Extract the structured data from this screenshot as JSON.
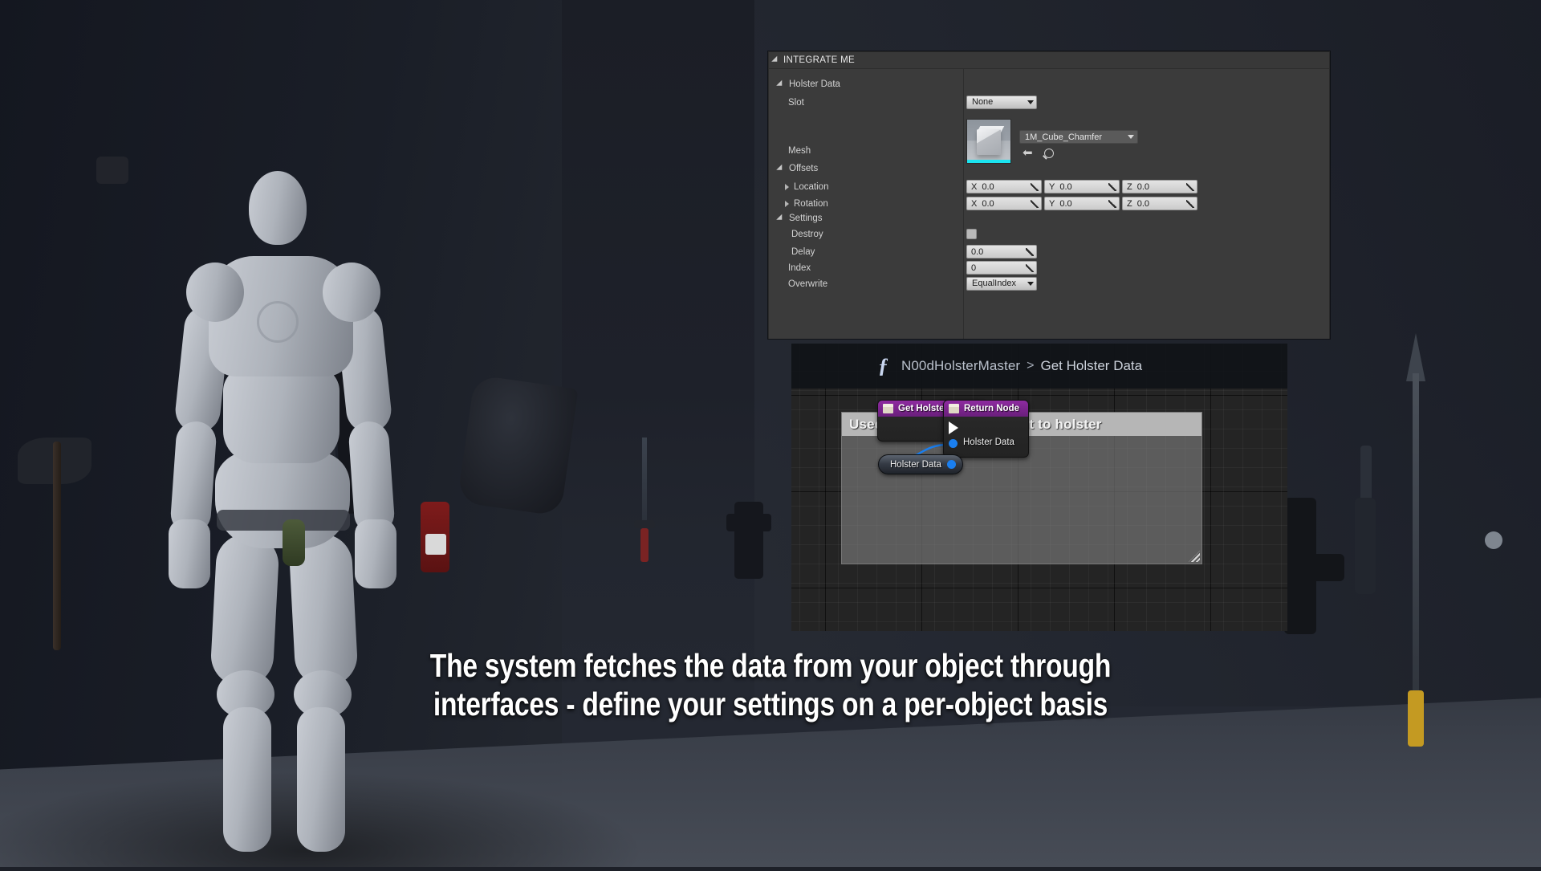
{
  "viewport": {
    "scene_description": "Unreal Engine mannequin with holstered weapons in a dark showcase room",
    "props": [
      "axe",
      "sword",
      "pistol",
      "rifle",
      "spear",
      "mace",
      "orb"
    ]
  },
  "details_panel": {
    "header": {
      "title": "INTEGRATE ME",
      "expander_icon": "triangle-down-icon"
    },
    "categories": [
      {
        "name": "Holster Data",
        "expander_icon": "triangle-down-icon"
      },
      {
        "name": "Offsets",
        "expander_icon": "triangle-down-icon"
      },
      {
        "name": "Settings",
        "expander_icon": "triangle-down-icon"
      }
    ],
    "properties": {
      "slot": {
        "label": "Slot",
        "value": "None",
        "widget": "combo-box",
        "caret_icon": "caret-down-icon"
      },
      "mesh": {
        "label": "Mesh",
        "value": "1M_Cube_Chamfer",
        "widget": "asset-picker",
        "thumbnail_name": "cube-thumbnail",
        "caret_icon": "caret-down-icon",
        "browse_icon": "arrow-left-icon",
        "search_icon": "magnifier-icon"
      },
      "location": {
        "label": "Location",
        "expander_icon": "triangle-right-icon",
        "axes": [
          {
            "axis": "X",
            "value": "0.0"
          },
          {
            "axis": "Y",
            "value": "0.0"
          },
          {
            "axis": "Z",
            "value": "0.0"
          }
        ]
      },
      "rotation": {
        "label": "Rotation",
        "expander_icon": "triangle-right-icon",
        "axes": [
          {
            "axis": "X",
            "value": "0.0"
          },
          {
            "axis": "Y",
            "value": "0.0"
          },
          {
            "axis": "Z",
            "value": "0.0"
          }
        ]
      },
      "destroy": {
        "label": "Destroy",
        "widget": "checkbox",
        "checked": false
      },
      "delay": {
        "label": "Delay",
        "value": "0.0",
        "widget": "number-field"
      },
      "index": {
        "label": "Index",
        "value": "0",
        "widget": "number-field"
      },
      "overwrite": {
        "label": "Overwrite",
        "value": "EqualIndex",
        "widget": "combo-box",
        "caret_icon": "caret-down-icon"
      }
    }
  },
  "graph": {
    "breadcrumb": {
      "function_icon": "function-f-icon",
      "parent": "N00dHolsterMaster",
      "separator": ">",
      "current": "Get Holster Data"
    },
    "comment": {
      "text": "Used in the object you want to holster",
      "resize_icon": "resize-grip-icon"
    },
    "nodes": [
      {
        "id": "get-holster-data",
        "title": "Get Holster Data",
        "icon": "function-node-icon",
        "exec_out_icon": "exec-pin-icon"
      },
      {
        "id": "return-node",
        "title": "Return Node",
        "icon": "function-node-icon",
        "exec_in_icon": "exec-pin-icon",
        "pins": [
          {
            "label": "Holster Data",
            "type": "struct",
            "pin_icon": "data-pin-icon"
          }
        ]
      },
      {
        "id": "holster-data-variable",
        "title": "Holster Data",
        "pin_icon": "data-pin-icon"
      }
    ],
    "colors": {
      "node_title": "#8e2ba0",
      "data_pin": "#1a7ff0",
      "exec_wire": "#ffffff",
      "data_wire": "#1a7ff0"
    }
  },
  "caption": {
    "line1": "The system fetches the data from your object through",
    "line2": "interfaces - define your settings on a per-object basis"
  }
}
